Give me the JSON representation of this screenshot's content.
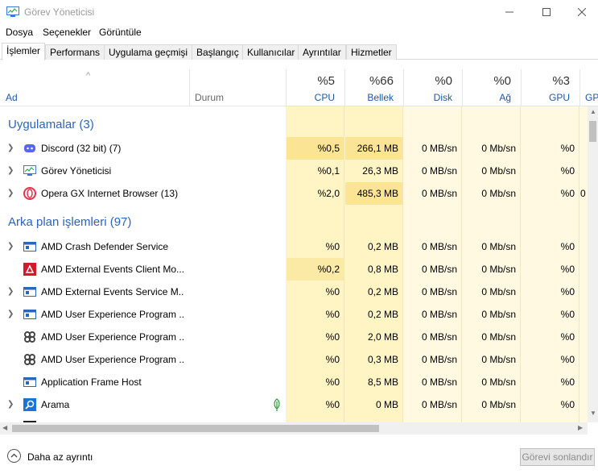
{
  "window": {
    "title": "Görev Yöneticisi"
  },
  "menu": [
    "Dosya",
    "Seçenekler",
    "Görüntüle"
  ],
  "tabs": [
    "İşlemler",
    "Performans",
    "Uygulama geçmişi",
    "Başlangıç",
    "Kullanıcılar",
    "Ayrıntılar",
    "Hizmetler"
  ],
  "header": {
    "name": "Ad",
    "status": "Durum",
    "cpu": {
      "pct": "%5",
      "label": "CPU"
    },
    "mem": {
      "pct": "%66",
      "label": "Bellek"
    },
    "disk": {
      "pct": "%0",
      "label": "Disk"
    },
    "net": {
      "pct": "%0",
      "label": "Ağ"
    },
    "gpu": {
      "pct": "%3",
      "label": "GPU"
    },
    "gpu2": "GPU"
  },
  "groups": {
    "apps": "Uygulamalar (3)",
    "background": "Arka plan işlemleri (97)"
  },
  "apps": [
    {
      "name": "Discord (32 bit) (7)",
      "cpu": "%0,5",
      "mem": "266,1 MB",
      "disk": "0 MB/sn",
      "net": "0 Mb/sn",
      "gpu": "%0",
      "icon": "discord-icon"
    },
    {
      "name": "Görev Yöneticisi",
      "cpu": "%0,1",
      "mem": "26,3 MB",
      "disk": "0 MB/sn",
      "net": "0 Mb/sn",
      "gpu": "%0",
      "icon": "task-manager-icon"
    },
    {
      "name": "Opera GX Internet Browser (13)",
      "cpu": "%2,0",
      "mem": "485,3 MB",
      "disk": "0 MB/sn",
      "net": "0 Mb/sn",
      "gpu": "%0",
      "gpu2": "0",
      "icon": "opera-gx-icon"
    }
  ],
  "background": [
    {
      "name": "AMD Crash Defender Service",
      "cpu": "%0",
      "mem": "0,2 MB",
      "disk": "0 MB/sn",
      "net": "0 Mb/sn",
      "gpu": "%0",
      "icon": "service-window-icon"
    },
    {
      "name": "AMD External Events Client Mo...",
      "cpu": "%0,2",
      "mem": "0,8 MB",
      "disk": "0 MB/sn",
      "net": "0 Mb/sn",
      "gpu": "%0",
      "icon": "amd-icon"
    },
    {
      "name": "AMD External Events Service M...",
      "cpu": "%0",
      "mem": "0,2 MB",
      "disk": "0 MB/sn",
      "net": "0 Mb/sn",
      "gpu": "%0",
      "icon": "service-window-icon"
    },
    {
      "name": "AMD User Experience Program ...",
      "cpu": "%0",
      "mem": "0,2 MB",
      "disk": "0 MB/sn",
      "net": "0 Mb/sn",
      "gpu": "%0",
      "icon": "service-window-icon"
    },
    {
      "name": "AMD User Experience Program ...",
      "cpu": "%0",
      "mem": "2,0 MB",
      "disk": "0 MB/sn",
      "net": "0 Mb/sn",
      "gpu": "%0",
      "icon": "gear-cluster-icon"
    },
    {
      "name": "AMD User Experience Program ...",
      "cpu": "%0",
      "mem": "0,3 MB",
      "disk": "0 MB/sn",
      "net": "0 Mb/sn",
      "gpu": "%0",
      "icon": "gear-cluster-icon"
    },
    {
      "name": "Application Frame Host",
      "cpu": "%0",
      "mem": "8,5 MB",
      "disk": "0 MB/sn",
      "net": "0 Mb/sn",
      "gpu": "%0",
      "icon": "service-window-icon"
    },
    {
      "name": "Arama",
      "cpu": "%0",
      "mem": "0 MB",
      "disk": "0 MB/sn",
      "net": "0 Mb/sn",
      "gpu": "%0",
      "icon": "search-icon"
    }
  ],
  "footer": {
    "fewer": "Daha az ayrıntı",
    "end_task": "Görevi sonlandır"
  },
  "colors": {
    "heat_light": "#fff9e1",
    "heat_mid": "#fff4c4",
    "heat_strong": "#fbe594",
    "group_blue": "#2e64b8",
    "header_blue": "#1f56a8"
  }
}
